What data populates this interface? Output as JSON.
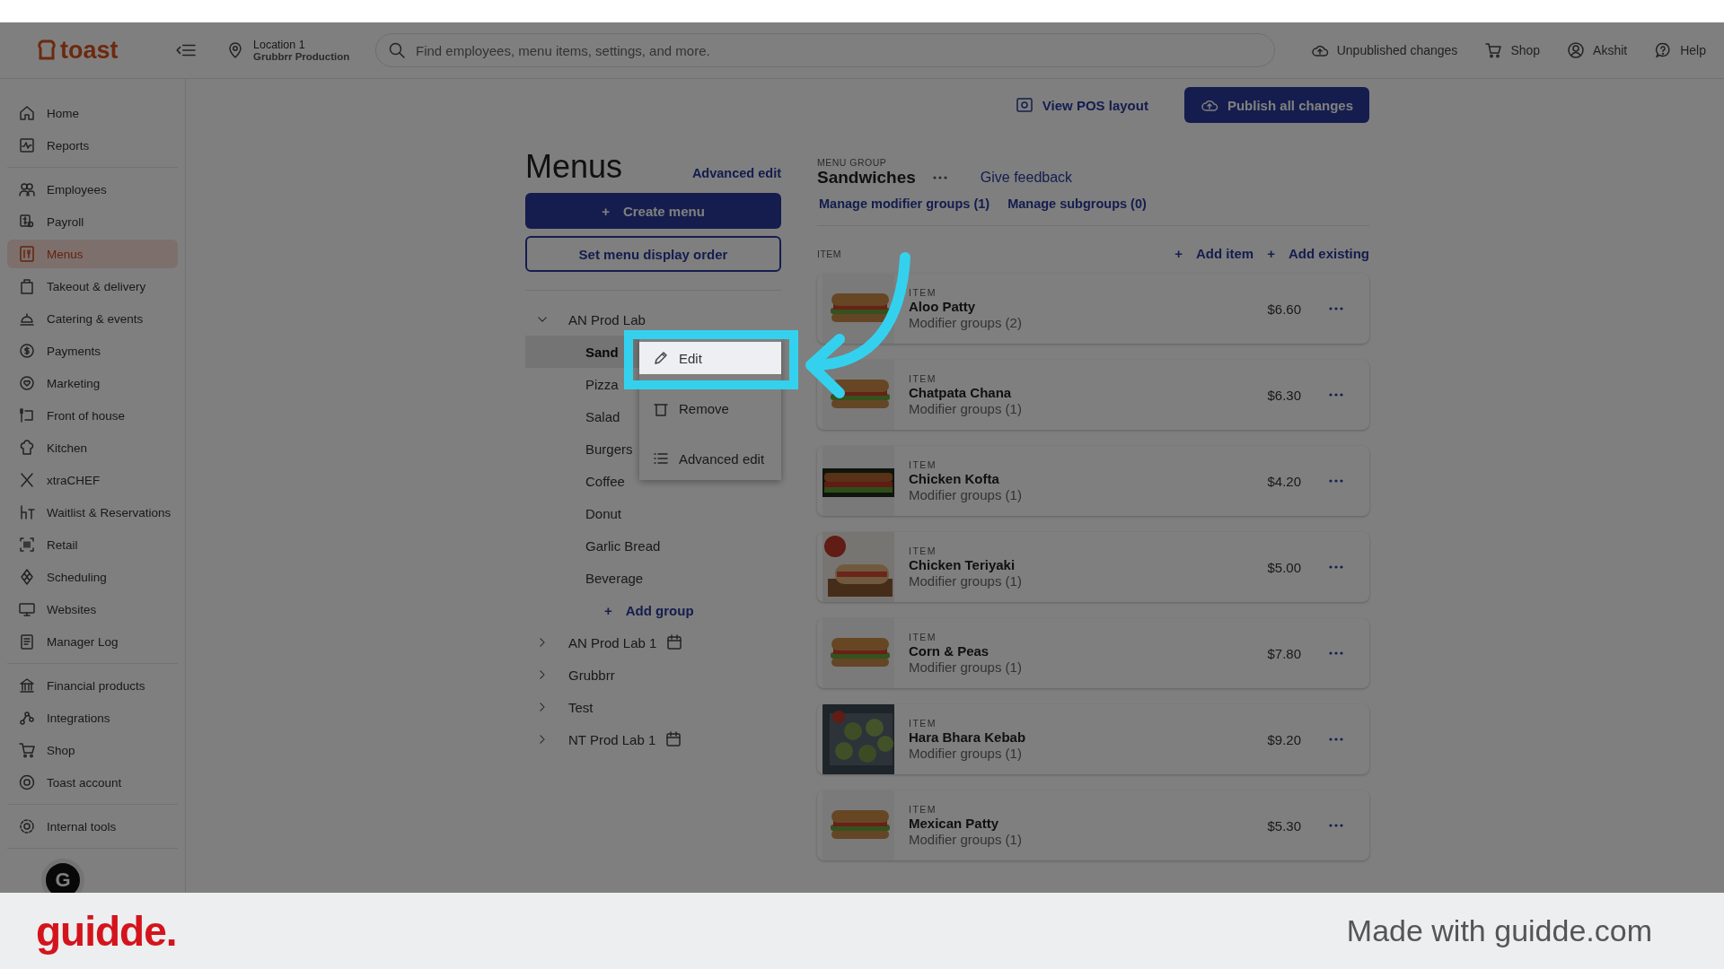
{
  "top_bar": {
    "logo": "toast",
    "location": {
      "name": "Location 1",
      "subtitle": "Grubbrr Production"
    },
    "search": {
      "placeholder": "Find employees, menu items, settings, and more."
    },
    "actions": [
      {
        "label": "Unpublished changes"
      },
      {
        "label": "Shop"
      },
      {
        "label": "Akshit"
      },
      {
        "label": "Help"
      }
    ]
  },
  "sidebar": {
    "sections": [
      [
        {
          "label": "Home",
          "selected": false
        },
        {
          "label": "Reports",
          "selected": false
        }
      ],
      [
        {
          "label": "Employees",
          "selected": false
        },
        {
          "label": "Payroll",
          "selected": false
        },
        {
          "label": "Menus",
          "selected": true
        },
        {
          "label": "Takeout & delivery",
          "selected": false
        },
        {
          "label": "Catering & events",
          "selected": false
        },
        {
          "label": "Payments",
          "selected": false
        },
        {
          "label": "Marketing",
          "selected": false
        },
        {
          "label": "Front of house",
          "selected": false
        },
        {
          "label": "Kitchen",
          "selected": false
        },
        {
          "label": "xtraCHEF",
          "selected": false
        },
        {
          "label": "Waitlist & Reservations",
          "selected": false
        },
        {
          "label": "Retail",
          "selected": false
        },
        {
          "label": "Scheduling",
          "selected": false
        },
        {
          "label": "Websites",
          "selected": false
        },
        {
          "label": "Manager Log",
          "selected": false
        }
      ],
      [
        {
          "label": "Financial products",
          "selected": false
        },
        {
          "label": "Integrations",
          "selected": false
        },
        {
          "label": "Shop",
          "selected": false
        },
        {
          "label": "Toast account",
          "selected": false
        }
      ],
      [
        {
          "label": "Internal tools",
          "selected": false
        }
      ]
    ],
    "badge": "G"
  },
  "toolbar": {
    "buttons": [
      {
        "label": "View POS layout",
        "kind": "link"
      },
      {
        "label": "Publish all changes",
        "kind": "primary"
      }
    ]
  },
  "menus_panel": {
    "title": "Menus",
    "link": "Advanced edit",
    "buttons": [
      {
        "icon": "+",
        "label": "Create menu",
        "kind": "primary"
      },
      {
        "label": "Set menu display order",
        "kind": "outline"
      }
    ],
    "tree": [
      {
        "label": "AN Prod Lab",
        "expanded": true,
        "scheduled": false,
        "children": [
          {
            "label": "Sand",
            "selected": true
          },
          {
            "label": "Pizza",
            "selected": false
          },
          {
            "label": "Salad",
            "selected": false
          },
          {
            "label": "Burgers",
            "selected": false
          },
          {
            "label": "Coffee",
            "selected": false
          },
          {
            "label": "Donut",
            "selected": false
          },
          {
            "label": "Garlic Bread",
            "selected": false
          },
          {
            "label": "Beverage",
            "selected": false
          }
        ],
        "add": {
          "icon": "+",
          "label": "Add group"
        }
      },
      {
        "label": "AN Prod Lab 1",
        "expanded": false,
        "scheduled": true
      },
      {
        "label": "Grubbrr",
        "expanded": false,
        "scheduled": false
      },
      {
        "label": "Test",
        "expanded": false,
        "scheduled": false
      },
      {
        "label": "NT Prod Lab 1",
        "expanded": false,
        "scheduled": true
      }
    ]
  },
  "context_menu": {
    "items": [
      {
        "label": "Edit",
        "highlighted": true
      },
      {
        "label": "Remove",
        "highlighted": false
      },
      {
        "label": "Advanced edit",
        "highlighted": false
      }
    ]
  },
  "menu_group": {
    "caption": "MENU GROUP",
    "name": "Sandwiches",
    "feedback": "Give feedback",
    "links": [
      "Manage modifier groups (1)",
      "Manage subgroups (0)"
    ]
  },
  "items": {
    "header": "ITEM",
    "actions": [
      {
        "icon": "+",
        "label": "Add item"
      },
      {
        "icon": "+",
        "label": "Add existing"
      }
    ],
    "rows": [
      {
        "caption": "ITEM",
        "name": "Aloo Patty",
        "detail": "Modifier groups (2)",
        "price": "$6.60"
      },
      {
        "caption": "ITEM",
        "name": "Chatpata Chana",
        "detail": "Modifier groups (1)",
        "price": "$6.30"
      },
      {
        "caption": "ITEM",
        "name": "Chicken Kofta",
        "detail": "Modifier groups (1)",
        "price": "$4.20"
      },
      {
        "caption": "ITEM",
        "name": "Chicken Teriyaki",
        "detail": "Modifier groups (1)",
        "price": "$5.00"
      },
      {
        "caption": "ITEM",
        "name": "Corn & Peas",
        "detail": "Modifier groups (1)",
        "price": "$7.80"
      },
      {
        "caption": "ITEM",
        "name": "Hara Bhara Kebab",
        "detail": "Modifier groups (1)",
        "price": "$9.20"
      },
      {
        "caption": "ITEM",
        "name": "Mexican Patty",
        "detail": "Modifier groups (1)",
        "price": "$5.30"
      }
    ]
  },
  "footer": {
    "logo": "guidde.",
    "note": "Made with guidde.com"
  }
}
